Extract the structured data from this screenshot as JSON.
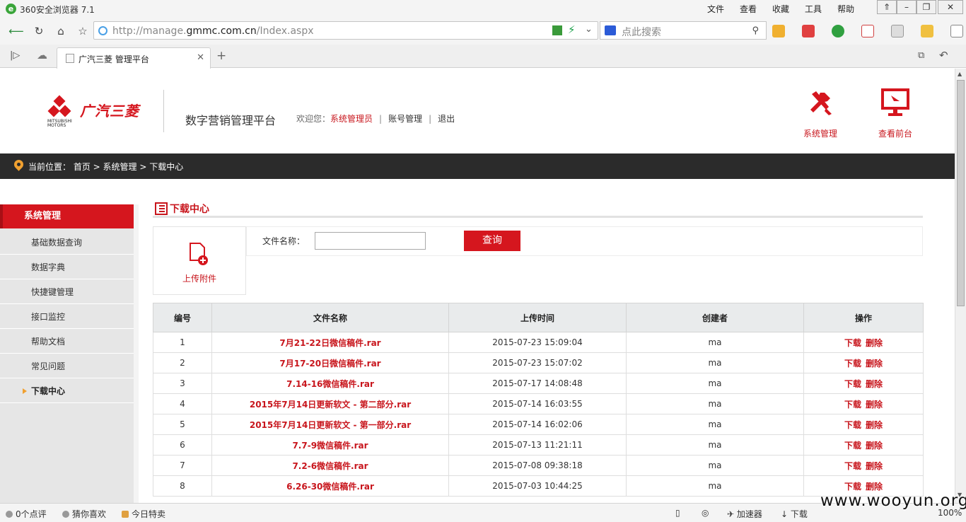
{
  "browser": {
    "title": "360安全浏览器 7.1",
    "menus": [
      "文件",
      "查看",
      "收藏",
      "工具",
      "帮助"
    ],
    "url_prefix": "http://manage.",
    "url_domain": "gmmc.com.cn",
    "url_suffix": "/Index.aspx",
    "search_placeholder": "点此搜索",
    "tab_title": "广汽三菱  管理平台"
  },
  "header": {
    "brand_text": "广汽三菱",
    "brand_small": "MITSUBISHI MOTORS",
    "platform_title": "数字营销管理平台",
    "welcome_prefix": "欢迎您：",
    "user": "系统管理员",
    "account_link": "账号管理",
    "logout_link": "退出",
    "sys_admin_label": "系统管理",
    "view_front_label": "查看前台"
  },
  "breadcrumb": {
    "prefix": "当前位置：",
    "path": "首页 > 系统管理 > 下载中心"
  },
  "sidebar": {
    "heading": "系统管理",
    "items": [
      {
        "label": "基础数据查询"
      },
      {
        "label": "数据字典"
      },
      {
        "label": "快捷键管理"
      },
      {
        "label": "接口监控"
      },
      {
        "label": "帮助文档"
      },
      {
        "label": "常见问题"
      },
      {
        "label": "下载中心",
        "active": true
      }
    ]
  },
  "main": {
    "section_title": "下载中心",
    "upload_label": "上传附件",
    "filter_label": "文件名称：",
    "filter_value": "",
    "query_button": "查询",
    "columns": [
      "编号",
      "文件名称",
      "上传时间",
      "创建者",
      "操作"
    ],
    "download_label": "下载",
    "delete_label": "删除",
    "rows": [
      {
        "id": "1",
        "name": "7月21-22日微信稿件.rar",
        "time": "2015-07-23 15:09:04",
        "creator": "ma"
      },
      {
        "id": "2",
        "name": "7月17-20日微信稿件.rar",
        "time": "2015-07-23 15:07:02",
        "creator": "ma"
      },
      {
        "id": "3",
        "name": "7.14-16微信稿件.rar",
        "time": "2015-07-17 14:08:48",
        "creator": "ma"
      },
      {
        "id": "4",
        "name": "2015年7月14日更新软文 - 第二部分.rar",
        "time": "2015-07-14 16:03:55",
        "creator": "ma"
      },
      {
        "id": "5",
        "name": "2015年7月14日更新软文 - 第一部分.rar",
        "time": "2015-07-14 16:02:06",
        "creator": "ma"
      },
      {
        "id": "6",
        "name": "7.7-9微信稿件.rar",
        "time": "2015-07-13 11:21:11",
        "creator": "ma"
      },
      {
        "id": "7",
        "name": "7.2-6微信稿件.rar",
        "time": "2015-07-08 09:38:18",
        "creator": "ma"
      },
      {
        "id": "8",
        "name": "6.26-30微信稿件.rar",
        "time": "2015-07-03 10:44:25",
        "creator": "ma"
      }
    ]
  },
  "statusbar": {
    "comments": "0个点评",
    "guess": "猜你喜欢",
    "deals": "今日特卖",
    "accelerator": "加速器",
    "download": "下载",
    "zoom": "100%"
  },
  "watermark": "www.wooyun.org",
  "colors": {
    "accent": "#d5161e",
    "dark_bar": "#2b2b2b"
  }
}
